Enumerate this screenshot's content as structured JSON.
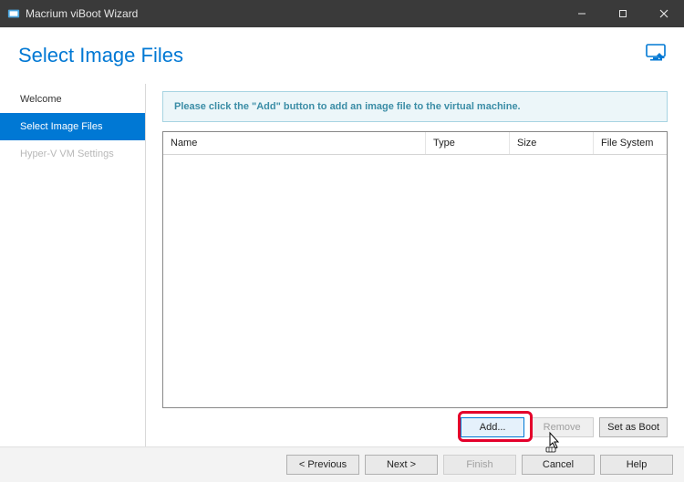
{
  "window": {
    "title": "Macrium viBoot Wizard"
  },
  "header": {
    "title": "Select Image Files"
  },
  "sidebar": {
    "items": [
      {
        "label": "Welcome",
        "state": "normal"
      },
      {
        "label": "Select Image Files",
        "state": "active"
      },
      {
        "label": "Hyper-V VM Settings",
        "state": "disabled"
      }
    ]
  },
  "main": {
    "info_text": "Please click the \"Add\" button to add an image file to the virtual machine.",
    "columns": {
      "name": "Name",
      "type": "Type",
      "size": "Size",
      "fs": "File System"
    },
    "rows": [],
    "actions": {
      "add": "Add...",
      "remove": "Remove",
      "boot": "Set as Boot"
    }
  },
  "footer": {
    "previous": "< Previous",
    "next": "Next >",
    "finish": "Finish",
    "cancel": "Cancel",
    "help": "Help"
  }
}
